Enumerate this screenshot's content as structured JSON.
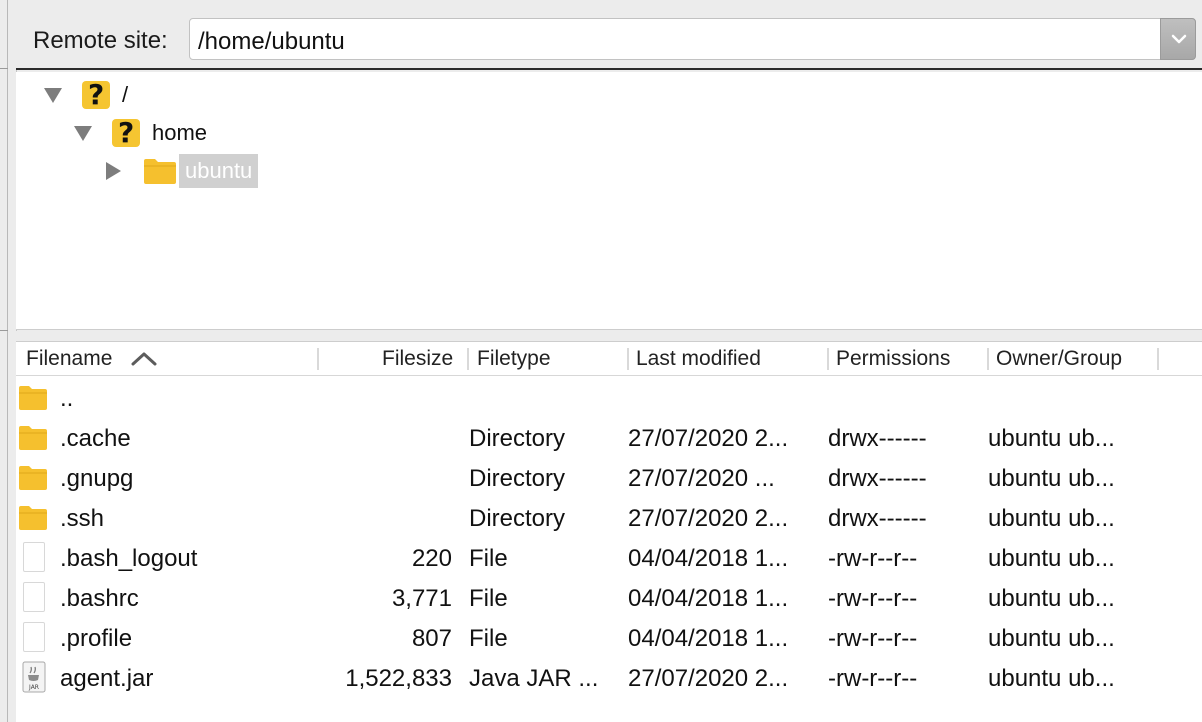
{
  "remote_site": {
    "label": "Remote site:",
    "path": "/home/ubuntu"
  },
  "tree": {
    "items": [
      {
        "label": "/",
        "icon": "question-icon",
        "expanded": true
      },
      {
        "label": "home",
        "icon": "question-icon",
        "expanded": true
      },
      {
        "label": "ubuntu",
        "icon": "folder-icon",
        "expanded": false,
        "selected": true
      }
    ]
  },
  "file_list": {
    "columns": [
      "Filename",
      "Filesize",
      "Filetype",
      "Last modified",
      "Permissions",
      "Owner/Group"
    ],
    "sort_indicator": "ascending",
    "rows": [
      {
        "icon": "folder-icon",
        "name": "..",
        "size": "",
        "type": "",
        "modified": "",
        "perms": "",
        "owner": ""
      },
      {
        "icon": "folder-icon",
        "name": ".cache",
        "size": "",
        "type": "Directory",
        "modified": "27/07/2020 2...",
        "perms": "drwx------",
        "owner": "ubuntu ub..."
      },
      {
        "icon": "folder-icon",
        "name": ".gnupg",
        "size": "",
        "type": "Directory",
        "modified": "27/07/2020 ...",
        "perms": "drwx------",
        "owner": "ubuntu ub..."
      },
      {
        "icon": "folder-icon",
        "name": ".ssh",
        "size": "",
        "type": "Directory",
        "modified": "27/07/2020 2...",
        "perms": "drwx------",
        "owner": "ubuntu ub..."
      },
      {
        "icon": "file-icon",
        "name": ".bash_logout",
        "size": "220",
        "type": "File",
        "modified": "04/04/2018 1...",
        "perms": "-rw-r--r--",
        "owner": "ubuntu ub..."
      },
      {
        "icon": "file-icon",
        "name": ".bashrc",
        "size": "3,771",
        "type": "File",
        "modified": "04/04/2018 1...",
        "perms": "-rw-r--r--",
        "owner": "ubuntu ub..."
      },
      {
        "icon": "file-icon",
        "name": ".profile",
        "size": "807",
        "type": "File",
        "modified": "04/04/2018 1...",
        "perms": "-rw-r--r--",
        "owner": "ubuntu ub..."
      },
      {
        "icon": "jar-icon",
        "name": "agent.jar",
        "size": "1,522,833",
        "type": "Java JAR ...",
        "modified": "27/07/2020 2...",
        "perms": "-rw-r--r--",
        "owner": "ubuntu ub..."
      }
    ]
  },
  "colors": {
    "folder": "#f5c02e",
    "question_icon": "#f5c531",
    "selection_bg": "#d0d0d0"
  }
}
